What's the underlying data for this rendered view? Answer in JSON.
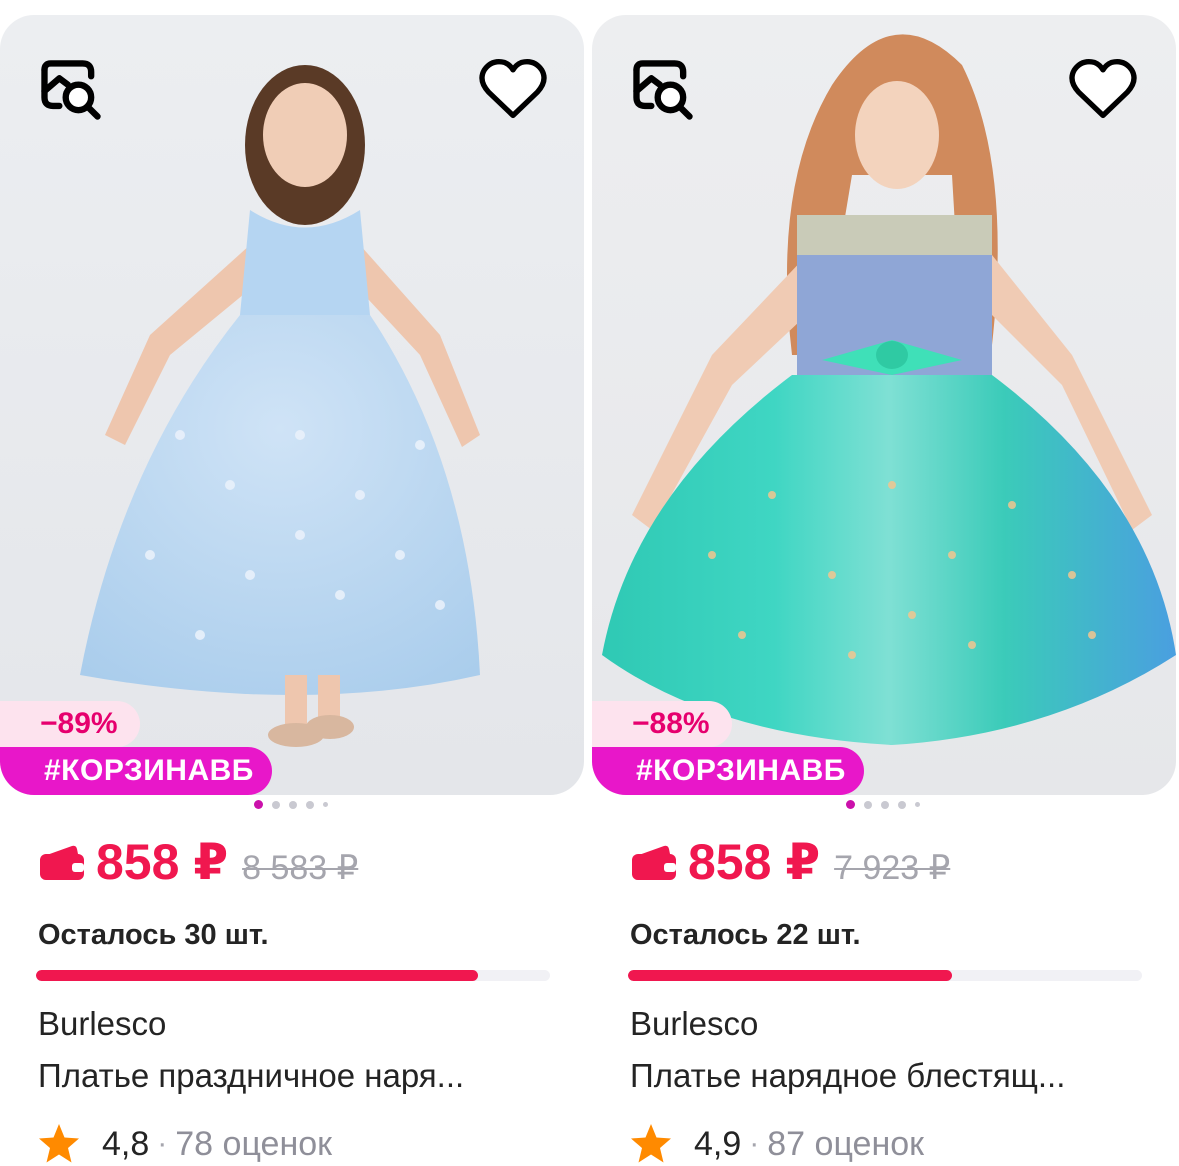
{
  "colors": {
    "accent_red": "#f0174f",
    "promo_magenta": "#e817c9",
    "discount_pink_bg": "#fde3ee",
    "discount_text": "#e6006e",
    "star_orange": "#ff8a00"
  },
  "icons": {
    "search": "image-search-icon",
    "favorite": "heart-outline-icon",
    "wallet": "wallet-icon",
    "rating": "star-icon"
  },
  "products": [
    {
      "discount": "−89%",
      "promo_tag": "#КОРЗИНАВБ",
      "price": "858 ₽",
      "old_price": "8 583 ₽",
      "stock_text": "Осталось 30 шт.",
      "stock_progress_percent": 86,
      "brand": "Burlesco",
      "title": "Платье праздничное наря...",
      "rating": "4,8",
      "separator": "·",
      "reviews": "78 оценок",
      "image_dots": 5,
      "active_dot": 0
    },
    {
      "discount": "−88%",
      "promo_tag": "#КОРЗИНАВБ",
      "price": "858 ₽",
      "old_price": "7 923 ₽",
      "stock_text": "Осталось 22 шт.",
      "stock_progress_percent": 63,
      "brand": "Burlesco",
      "title": "Платье нарядное блестящ...",
      "rating": "4,9",
      "separator": "·",
      "reviews": "87 оценок",
      "image_dots": 5,
      "active_dot": 0
    }
  ]
}
